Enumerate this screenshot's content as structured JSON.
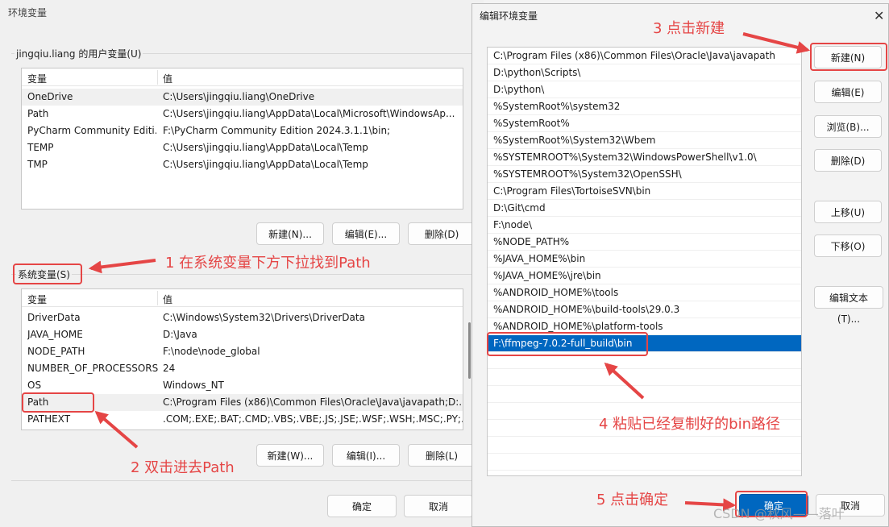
{
  "left_window": {
    "title": "环境变量",
    "user_group_label": "jingqiu.liang 的用户变量(U)",
    "columns": [
      "变量",
      "值"
    ],
    "user_vars": [
      {
        "name": "OneDrive",
        "value": "C:\\Users\\jingqiu.liang\\OneDrive"
      },
      {
        "name": "Path",
        "value": "C:\\Users\\jingqiu.liang\\AppData\\Local\\Microsoft\\WindowsAp..."
      },
      {
        "name": "PyCharm Community Editi...",
        "value": "F:\\PyCharm Community Edition 2024.3.1.1\\bin;"
      },
      {
        "name": "TEMP",
        "value": "C:\\Users\\jingqiu.liang\\AppData\\Local\\Temp"
      },
      {
        "name": "TMP",
        "value": "C:\\Users\\jingqiu.liang\\AppData\\Local\\Temp"
      }
    ],
    "user_buttons": {
      "new": "新建(N)...",
      "edit": "编辑(E)...",
      "delete": "删除(D)"
    },
    "system_group_label": "系统变量(S)",
    "system_vars": [
      {
        "name": "DriverData",
        "value": "C:\\Windows\\System32\\Drivers\\DriverData"
      },
      {
        "name": "JAVA_HOME",
        "value": "D:\\Java"
      },
      {
        "name": "NODE_PATH",
        "value": "F:\\node\\node_global"
      },
      {
        "name": "NUMBER_OF_PROCESSORS",
        "value": "24"
      },
      {
        "name": "OS",
        "value": "Windows_NT"
      },
      {
        "name": "Path",
        "value": "C:\\Program Files (x86)\\Common Files\\Oracle\\Java\\javapath;D:..."
      },
      {
        "name": "PATHEXT",
        "value": ".COM;.EXE;.BAT;.CMD;.VBS;.VBE;.JS;.JSE;.WSF;.WSH;.MSC;.PY;.P..."
      }
    ],
    "system_buttons": {
      "new": "新建(W)...",
      "edit": "编辑(I)...",
      "delete": "删除(L)"
    },
    "ok": "确定",
    "cancel": "取消"
  },
  "edit_dialog": {
    "title": "编辑环境变量",
    "close_glyph": "✕",
    "paths": [
      "C:\\Program Files (x86)\\Common Files\\Oracle\\Java\\javapath",
      "D:\\python\\Scripts\\",
      "D:\\python\\",
      "%SystemRoot%\\system32",
      "%SystemRoot%",
      "%SystemRoot%\\System32\\Wbem",
      "%SYSTEMROOT%\\System32\\WindowsPowerShell\\v1.0\\",
      "%SYSTEMROOT%\\System32\\OpenSSH\\",
      "C:\\Program Files\\TortoiseSVN\\bin",
      "D:\\Git\\cmd",
      "F:\\node\\",
      "%NODE_PATH%",
      "%JAVA_HOME%\\bin",
      "%JAVA_HOME%\\jre\\bin",
      "%ANDROID_HOME%\\tools",
      "%ANDROID_HOME%\\build-tools\\29.0.3",
      "%ANDROID_HOME%\\platform-tools",
      "F:\\ffmpeg-7.0.2-full_build\\bin"
    ],
    "buttons": {
      "new": "新建(N)",
      "edit": "编辑(E)",
      "browse": "浏览(B)...",
      "delete": "删除(D)",
      "move_up": "上移(U)",
      "move_down": "下移(O)",
      "edit_text": "编辑文本(T)...",
      "ok": "确定",
      "cancel": "取消"
    }
  },
  "annotations": {
    "step1": "1 在系统变量下方下拉找到Path",
    "step2": "2 双击进去Path",
    "step3": "3 点击新建",
    "step4": "4 粘贴已经复制好的bin路径",
    "step5": "5 点击确定"
  },
  "watermark": "CSDN @秋风——落叶",
  "colors": {
    "annotation": "#e54545",
    "selection": "#0067c0"
  }
}
